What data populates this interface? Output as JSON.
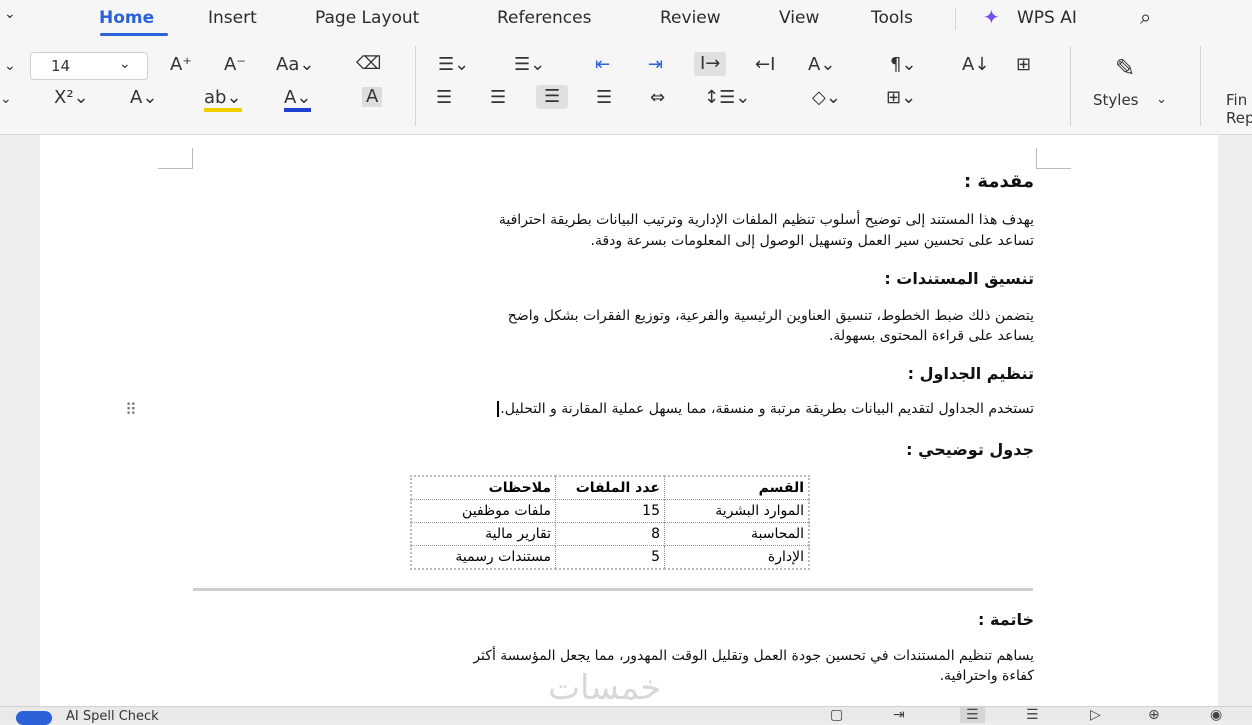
{
  "menu": {
    "tabs": [
      {
        "label": "Home"
      },
      {
        "label": "Insert"
      },
      {
        "label": "Page Layout"
      },
      {
        "label": "References"
      },
      {
        "label": "Review"
      },
      {
        "label": "View"
      },
      {
        "label": "Tools"
      }
    ],
    "wps_ai_label": "WPS AI"
  },
  "ribbon": {
    "font_size": "14",
    "styles_label": "Styles",
    "find_replace_line1": "Fin",
    "find_replace_line2": "Rep"
  },
  "document": {
    "h_intro": "مقدمة :",
    "p_intro_1": "يهدف هذا المستند إلى توضيح أسلوب تنظيم الملفات الإدارية وترتيب البيانات بطريقة احترافية",
    "p_intro_2": "تساعد على تحسين سير العمل وتسهيل الوصول إلى المعلومات بسرعة ودقة.",
    "h_format": "تنسيق المستندات :",
    "p_format_1": "يتضمن ذلك ضبط الخطوط، تنسيق العناوين الرئيسية والفرعية، وتوزيع الفقرات بشكل واضح",
    "p_format_2": "يساعد على قراءة المحتوى بسهولة.",
    "h_tables": "تنظيم الجداول :",
    "p_tables": "تستخدم الجداول لتقديم البيانات بطريقة مرتبة و منسقة، مما يسهل عملية المقارنة و التحليل.",
    "h_sample": "جدول توضيحي :",
    "table": {
      "headers": [
        "القسم",
        "عدد الملفات",
        "ملاحظات"
      ],
      "rows": [
        [
          "الموارد البشرية",
          "15",
          "ملفات موظفين"
        ],
        [
          "المحاسبة",
          "8",
          "تقارير مالية"
        ],
        [
          "الإدارة",
          "5",
          "مستندات رسمية"
        ]
      ]
    },
    "h_conclusion": "خاتمة :",
    "p_conclusion_1": "يساهم تنظيم المستندات في تحسين جودة العمل وتقليل الوقت المهدور، مما يجعل المؤسسة أكثر",
    "p_conclusion_2": "كفاءة واحترافية."
  },
  "statusbar": {
    "spell_check": "AI Spell Check"
  },
  "watermark": "خمسات"
}
